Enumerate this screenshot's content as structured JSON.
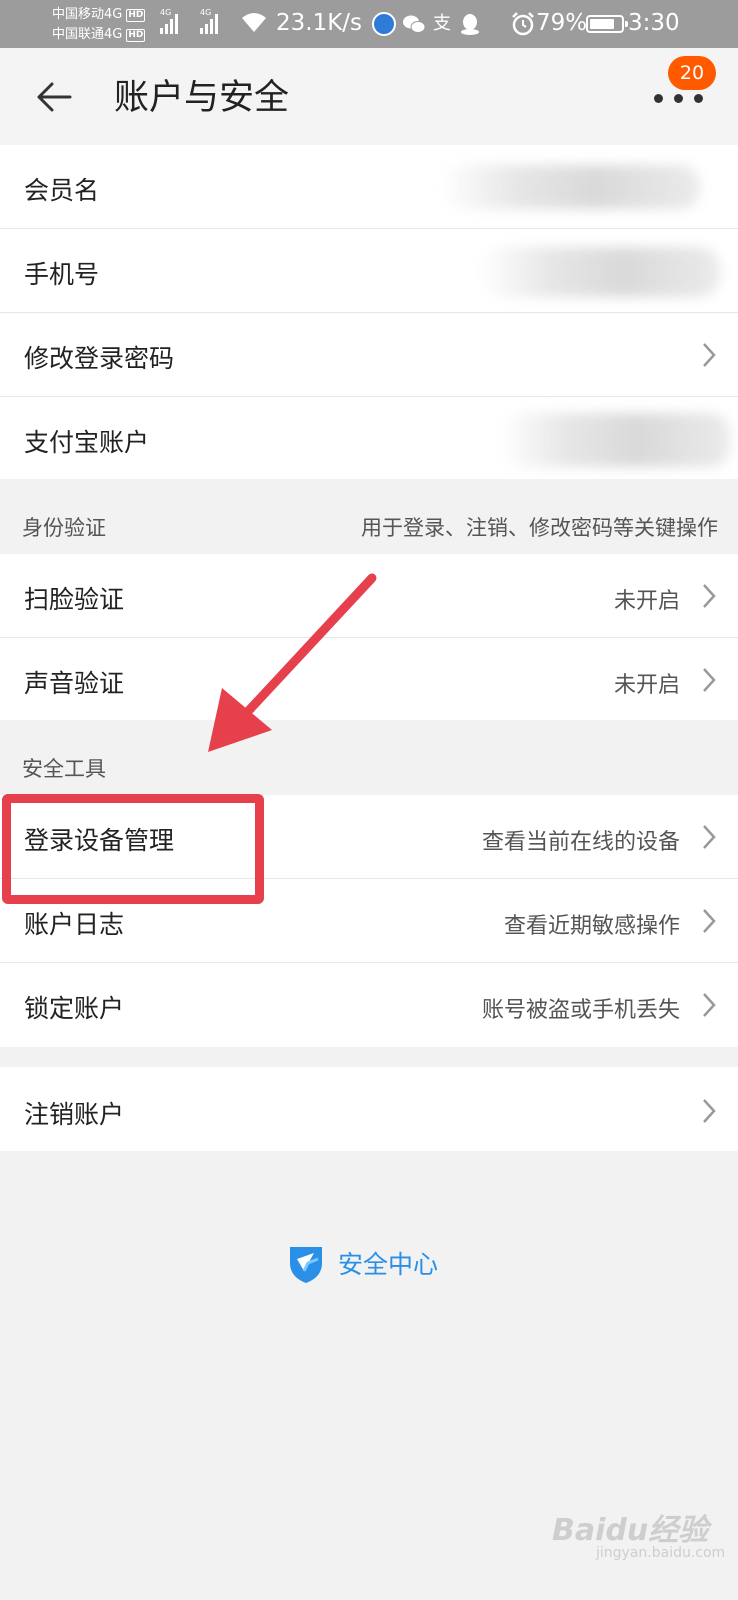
{
  "status_bar": {
    "carrier_1": "中国移动4G",
    "carrier_2": "中国联通4G",
    "hd_label": "HD",
    "network_label": "4G",
    "speed": "23.1K/s",
    "alipay_glyph": "支",
    "battery_percent": "79%",
    "battery_level": 0.79,
    "time": "3:30",
    "icons": [
      "signal-icon",
      "wifi-icon",
      "browser-icon",
      "wechat-icon",
      "alipay-icon",
      "qq-icon",
      "alarm-icon",
      "battery-icon"
    ]
  },
  "header": {
    "title": "账户与安全",
    "badge_count": "20",
    "badge_color": "#ff5a00"
  },
  "account_rows": [
    {
      "label": "会员名"
    },
    {
      "label": "手机号"
    },
    {
      "label": "修改登录密码"
    },
    {
      "label": "支付宝账户"
    }
  ],
  "identity_section": {
    "title": "身份验证",
    "description": "用于登录、注销、修改密码等关键操作",
    "rows": [
      {
        "label": "扫脸验证",
        "value": "未开启"
      },
      {
        "label": "声音验证",
        "value": "未开启"
      }
    ]
  },
  "tools_section": {
    "title": "安全工具",
    "rows": [
      {
        "label": "登录设备管理",
        "value": "查看当前在线的设备"
      },
      {
        "label": "账户日志",
        "value": "查看近期敏感操作"
      },
      {
        "label": "锁定账户",
        "value": "账号被盗或手机丢失"
      }
    ]
  },
  "cancel_row": {
    "label": "注销账户"
  },
  "footer": {
    "brand": "安全中心",
    "brand_color": "#2a8fe6"
  },
  "annotation": {
    "highlight_color": "#e5404c"
  },
  "watermark": {
    "text": "Baidu经验",
    "sub": "jingyan.baidu.com"
  }
}
